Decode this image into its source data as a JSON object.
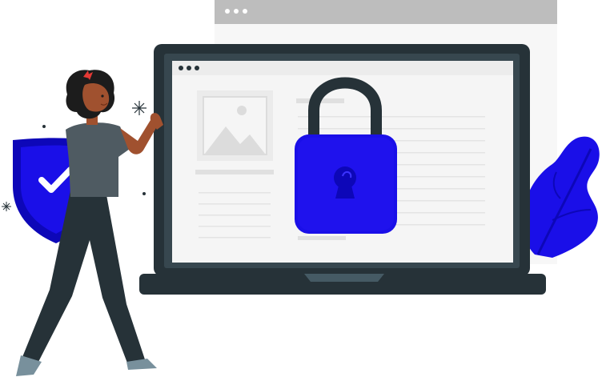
{
  "illustration": {
    "theme": "online-security",
    "elements": [
      "browser-window",
      "laptop",
      "padlock",
      "shield",
      "checkmark",
      "person",
      "leaf",
      "sparkles"
    ],
    "colors": {
      "accent": "#1a0fe8",
      "accent_dark": "#0d07b8",
      "laptop_frame": "#263238",
      "screen": "#f5f5f5",
      "window_bar": "#bdbdbd",
      "placeholder": "#e6e6e6",
      "skin": "#a0512f",
      "hair": "#1c1c1c",
      "shirt": "#4f5b62",
      "pants": "#263238"
    }
  }
}
